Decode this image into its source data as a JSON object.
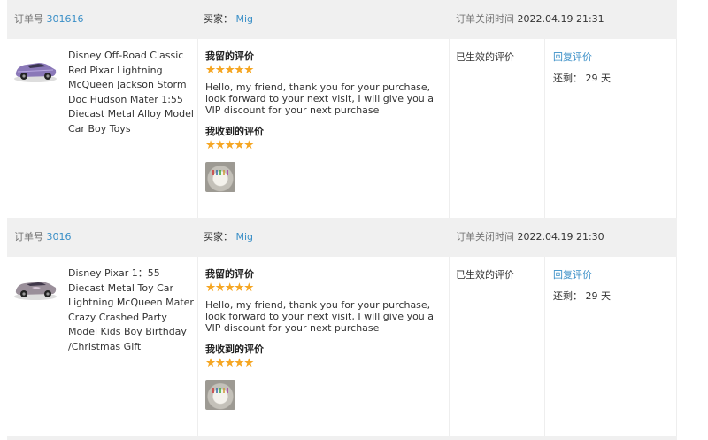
{
  "orders": [
    {
      "order_id_label": "订单号",
      "order_id": "301616",
      "buyer_label": "买家：",
      "buyer_name": "Mig",
      "closed_label": "订单关闭时间",
      "closed_time": "2022.04.19 21:31",
      "product_title": "Disney Off-Road Classic Red Pixar Lightning McQueen Jackson Storm Doc Hudson Mater 1:55 Diecast Metal Alloy Model Car Boy Toys",
      "car_color": "#8a78b8",
      "my_review_title": "我留的评价",
      "my_review_stars": "★★★★★",
      "my_review_rating": 5,
      "my_review_text": "Hello, my friend, thank you for your purchase, look forward to your next visit, I will give you a VIP discount for your next purchase",
      "received_review_title": "我收到的评价",
      "received_review_stars": "★★★★★",
      "received_review_rating": 5,
      "status": "已生效的评价",
      "reply_link": "回复评价",
      "remaining_label": "还剩：",
      "remaining_value": "29 天"
    },
    {
      "order_id_label": "订单号",
      "order_id": "3016",
      "buyer_label": "买家：",
      "buyer_name": "Mig",
      "closed_label": "订单关闭时间",
      "closed_time": "2022.04.19 21:30",
      "product_title": "Disney Pixar 1：55 Diecast Metal Toy Car Lightning McQueen Mater Crazy Crashed Party Model Kids Boy Birthday /Christmas Gift",
      "car_color": "#9a8f9a",
      "my_review_title": "我留的评价",
      "my_review_stars": "★★★★★",
      "my_review_rating": 5,
      "my_review_text": "Hello, my friend, thank you for your purchase, look forward to your next visit, I will give you a VIP discount for your next purchase",
      "received_review_title": "我收到的评价",
      "received_review_stars": "★★★★★",
      "received_review_rating": 5,
      "status": "已生效的评价",
      "reply_link": "回复评价",
      "remaining_label": "还剩：",
      "remaining_value": "29 天"
    }
  ],
  "colors": {
    "link": "#3a8fc7",
    "star": "#f5a623",
    "header_bg": "#f0f0f0"
  }
}
